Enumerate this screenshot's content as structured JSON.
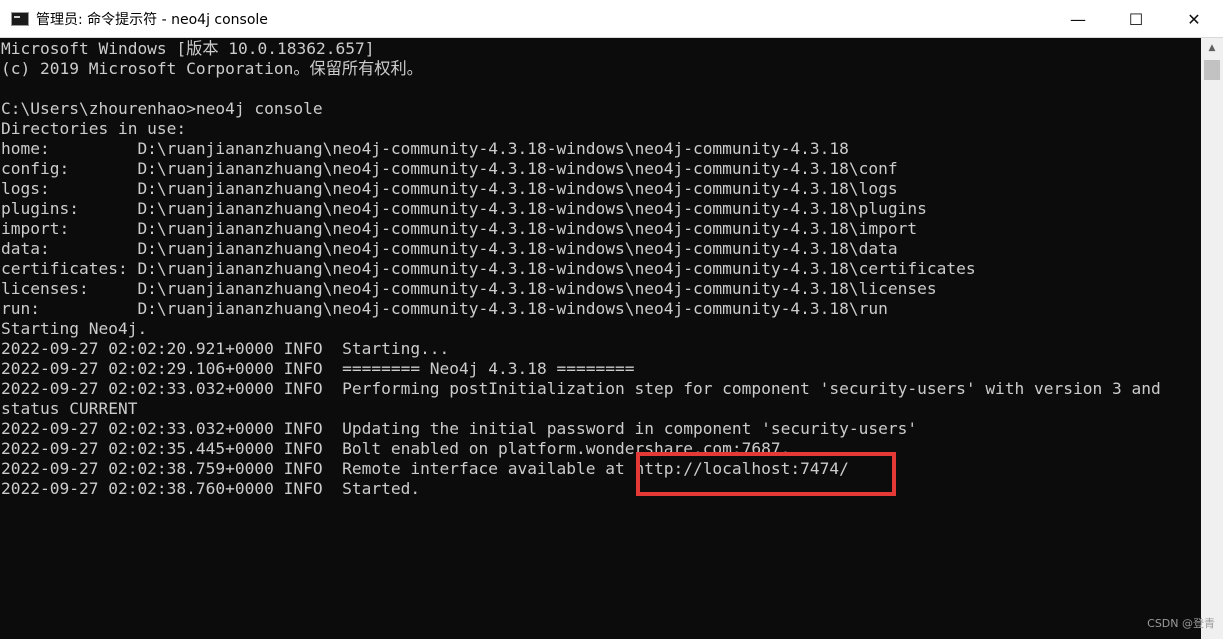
{
  "window": {
    "title": "管理员: 命令提示符 - neo4j  console",
    "controls": {
      "minimize": "—",
      "maximize": "☐",
      "close": "✕"
    }
  },
  "console": {
    "lines": [
      "Microsoft Windows [版本 10.0.18362.657]",
      "(c) 2019 Microsoft Corporation。保留所有权利。",
      "",
      "C:\\Users\\zhourenhao>neo4j console",
      "Directories in use:",
      "home:         D:\\ruanjiananzhuang\\neo4j-community-4.3.18-windows\\neo4j-community-4.3.18",
      "config:       D:\\ruanjiananzhuang\\neo4j-community-4.3.18-windows\\neo4j-community-4.3.18\\conf",
      "logs:         D:\\ruanjiananzhuang\\neo4j-community-4.3.18-windows\\neo4j-community-4.3.18\\logs",
      "plugins:      D:\\ruanjiananzhuang\\neo4j-community-4.3.18-windows\\neo4j-community-4.3.18\\plugins",
      "import:       D:\\ruanjiananzhuang\\neo4j-community-4.3.18-windows\\neo4j-community-4.3.18\\import",
      "data:         D:\\ruanjiananzhuang\\neo4j-community-4.3.18-windows\\neo4j-community-4.3.18\\data",
      "certificates: D:\\ruanjiananzhuang\\neo4j-community-4.3.18-windows\\neo4j-community-4.3.18\\certificates",
      "licenses:     D:\\ruanjiananzhuang\\neo4j-community-4.3.18-windows\\neo4j-community-4.3.18\\licenses",
      "run:          D:\\ruanjiananzhuang\\neo4j-community-4.3.18-windows\\neo4j-community-4.3.18\\run",
      "Starting Neo4j.",
      "2022-09-27 02:02:20.921+0000 INFO  Starting...",
      "2022-09-27 02:02:29.106+0000 INFO  ======== Neo4j 4.3.18 ========",
      "2022-09-27 02:02:33.032+0000 INFO  Performing postInitialization step for component 'security-users' with version 3 and",
      "status CURRENT",
      "2022-09-27 02:02:33.032+0000 INFO  Updating the initial password in component 'security-users'",
      "2022-09-27 02:02:35.445+0000 INFO  Bolt enabled on platform.wondershare.com:7687.",
      "2022-09-27 02:02:38.759+0000 INFO  Remote interface available at http://localhost:7474/",
      "2022-09-27 02:02:38.760+0000 INFO  Started."
    ]
  },
  "watermark": "CSDN @登青",
  "colors": {
    "console_bg": "#0c0c0c",
    "console_text": "#cccccc",
    "highlight": "#e53935"
  }
}
